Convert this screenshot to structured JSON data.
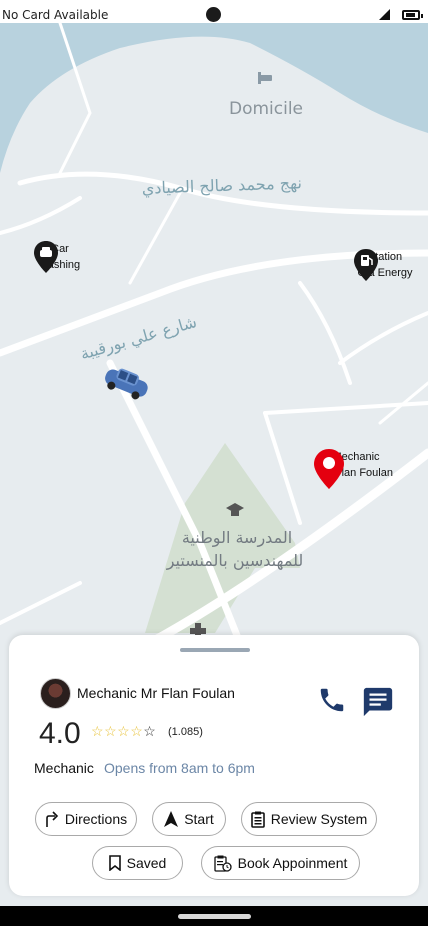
{
  "status_bar": {
    "carrier_text": "No Card Available",
    "icons": [
      "camera-cutout",
      "signal-icon",
      "battery-icon"
    ]
  },
  "map": {
    "place_labels": {
      "domicile": "Domicile",
      "street_1": "نهج محمد صالح الصيادي",
      "street_2": "شارع علي بورقيبة",
      "school_line1": "المدرسة الوطنية",
      "school_line2": "للمهندسين بالمنستير"
    },
    "markers": {
      "car_washing": {
        "line1": "Car",
        "line2": "washing"
      },
      "station": {
        "line1": "Station",
        "line2": "Ola Energy"
      },
      "mechanic": {
        "line1": "Mechanic",
        "line2": "Mr Flan Foulan",
        "color": "#e4000f"
      }
    },
    "colors": {
      "water": "#b8d2de",
      "land": "#e7ecef",
      "park": "#d4e0d2",
      "road": "#ffffff"
    }
  },
  "detail_card": {
    "name": "Mechanic Mr Flan Foulan",
    "rating": "4.0",
    "stars_filled": 4,
    "stars_total": 5,
    "review_count": "(1.085)",
    "category": "Mechanic",
    "hours": "Opens from 8am to 6pm",
    "accent_color": "#1f3a6b",
    "actions": {
      "directions": "Directions",
      "start": "Start",
      "review": "Review System",
      "saved": "Saved",
      "book": "Book Appoinment"
    }
  }
}
